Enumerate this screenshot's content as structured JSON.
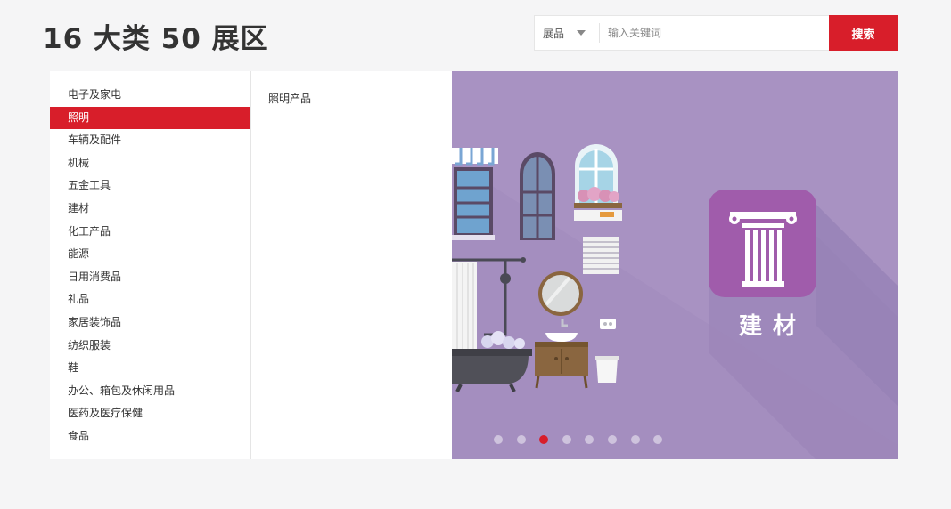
{
  "header": {
    "title": "16 大类 50 展区"
  },
  "search": {
    "category": "展品",
    "placeholder": "输入关键词",
    "button_label": "搜索"
  },
  "categories": [
    "电子及家电",
    "照明",
    "车辆及配件",
    "机械",
    "五金工具",
    "建材",
    "化工产品",
    "能源",
    "日用消费品",
    "礼品",
    "家居装饰品",
    "纺织服装",
    "鞋",
    "办公、箱包及休闲用品",
    "医药及医疗保健",
    "食品"
  ],
  "active_category_index": 1,
  "subcategories": [
    "照明产品"
  ],
  "banner": {
    "label": "建材",
    "icon": "ionic-column-icon",
    "background": "#a892c2",
    "slide_count": 8,
    "active_slide_index": 2
  },
  "colors": {
    "accent": "#d81e2a",
    "text": "#333333"
  }
}
